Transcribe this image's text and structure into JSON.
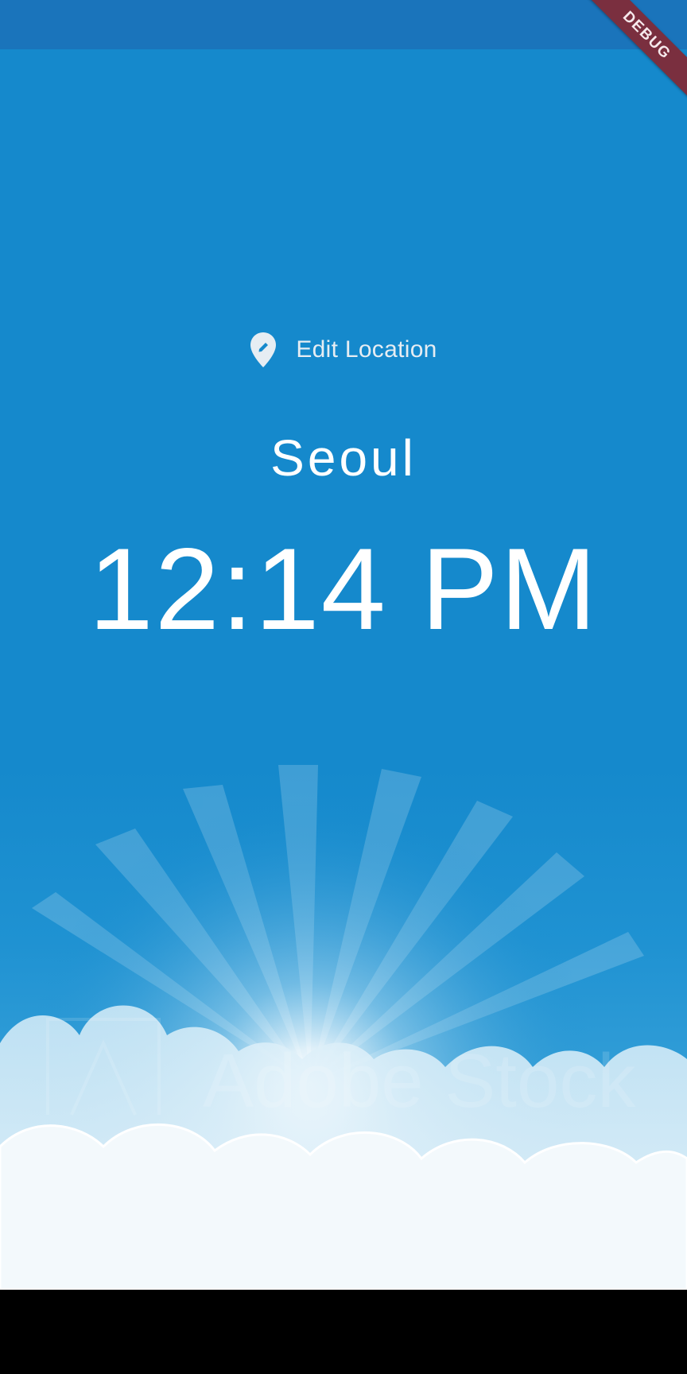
{
  "colors": {
    "status_bar": "#1a74bb",
    "background": "#1589cc",
    "text_primary": "#ffffff",
    "text_secondary": "#e6edf3",
    "debug_banner": "#7a2f3f",
    "nav_bar": "#000000"
  },
  "location_button": {
    "icon": "edit-location-icon",
    "label": "Edit Location"
  },
  "city": "Seoul",
  "time": "12:14 PM",
  "background_art": {
    "icon": "sky-clouds-sunburst-image",
    "watermark_text": "Adobe Stock"
  },
  "debug_banner": {
    "label": "DEBUG"
  }
}
